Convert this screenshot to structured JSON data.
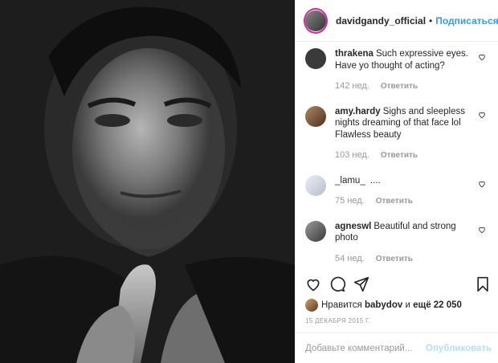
{
  "post": {
    "username": "davidgandy_official",
    "separator": "•",
    "follow_label": "Подписаться",
    "more_label": "•••"
  },
  "comments": [
    {
      "user": "thrakena",
      "text": "Such expressive eyes. Have yo thought of acting?",
      "time": "142 нед.",
      "reply": "Ответить",
      "avatar_color": "#3a3a3a"
    },
    {
      "user": "amy.hardy",
      "text": "Sighs and sleepless nights dreaming of that face lol Flawless beauty",
      "time": "103 нед.",
      "reply": "Ответить",
      "avatar_color": "#8a6a4a"
    },
    {
      "user": "_lamu_",
      "text": "....",
      "time": "75 нед.",
      "reply": "Ответить",
      "avatar_color": "#d8d8e0"
    },
    {
      "user": "agneswl",
      "text": "Beautiful and strong photo",
      "time": "54 нед.",
      "reply": "Ответить",
      "avatar_color": "#6f6f6f"
    }
  ],
  "actions": {
    "like_icon": "heart-icon",
    "comment_icon": "comment-icon",
    "share_icon": "share-icon",
    "save_icon": "bookmark-icon"
  },
  "likes": {
    "prefix": "Нравится",
    "user": "babydov",
    "conj": "и",
    "rest": "ещё 22 050"
  },
  "date": "15 ДЕКАБРЯ 2015 Г.",
  "add_comment": {
    "placeholder": "Добавьте комментарий...",
    "publish_label": "Опубликовать"
  }
}
